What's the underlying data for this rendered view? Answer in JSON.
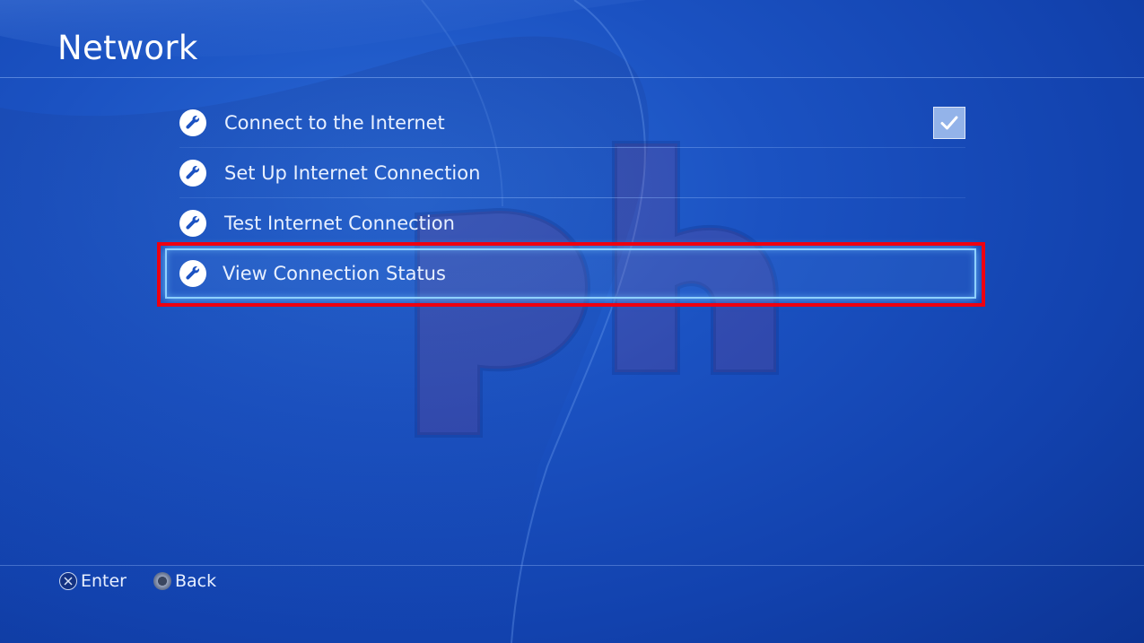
{
  "header": {
    "title": "Network"
  },
  "menu": {
    "items": [
      {
        "label": "Connect to the Internet",
        "icon": "wrench-icon",
        "checked": true
      },
      {
        "label": "Set Up Internet Connection",
        "icon": "wrench-icon"
      },
      {
        "label": "Test Internet Connection",
        "icon": "wrench-icon"
      },
      {
        "label": "View Connection Status",
        "icon": "wrench-icon",
        "selected": true
      }
    ]
  },
  "footer": {
    "enter_label": "Enter",
    "back_label": "Back"
  },
  "colors": {
    "background": "#1b52c2",
    "annotation_box": "#ee0010",
    "selection_glow": "#8fd0ff"
  }
}
